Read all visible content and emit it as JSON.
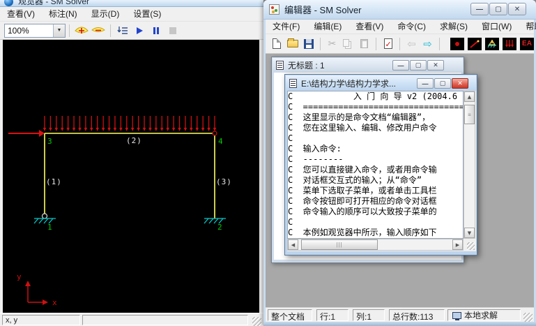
{
  "viewer": {
    "title": "观览器 - SM Solver",
    "menu": [
      "查看(V)",
      "标注(N)",
      "显示(D)",
      "设置(S)"
    ],
    "toolbar": {
      "zoom_value": "100%"
    },
    "status": {
      "coords_label": "x, y"
    },
    "diagram": {
      "load_arrow_count": 30,
      "labels": {
        "node1": "1",
        "node2": "2",
        "node3": "3",
        "node4": "4",
        "member1": "(1)",
        "member2": "(2)",
        "member3": "(3)",
        "axis_x": "x",
        "axis_y": "y"
      },
      "colors": {
        "member": "#ffff66",
        "load": "#cc1111",
        "support": "#00c8c8",
        "node_label": "#00cc00",
        "member_label": "#e8e8e8",
        "background": "#000000"
      }
    }
  },
  "editor": {
    "title": "编辑器 - SM Solver",
    "menu": [
      "文件(F)",
      "编辑(E)",
      "查看(V)",
      "命令(C)",
      "求解(S)",
      "窗口(W)",
      "帮助(H)"
    ],
    "toolbar": {
      "ea_label": "EA"
    },
    "window_buttons": {
      "minimize": "—",
      "maximize": "▢",
      "close": "✕"
    },
    "untitled_window": {
      "title": "无标题 : 1"
    },
    "doc_window": {
      "title": "E:\\结构力学\\结构力学求...",
      "lines": [
        "C            入 门 向 导 v2 (2004.6",
        "C  =================================",
        "C  这里显示的是命令文档“编辑器”，",
        "C  您在这里输入、编辑、修改用户命令",
        "C",
        "C  输入命令:",
        "C  --------",
        "C  您可以直接键入命令，或者用命令输",
        "C  对话框交互式的输入；从“命令”",
        "C  菜单下选取子菜单，或者单击工具栏",
        "C  命令按钮即可打开相应的命令对话框",
        "C  命令输入的顺序可以大致按子菜单的",
        "C",
        "C  本例如观览器中所示，输入顺序如下"
      ]
    },
    "status": {
      "scope": "整个文档",
      "row": "行:1",
      "col": "列:1",
      "total_lines": "总行数:113",
      "solver": "本地求解"
    }
  }
}
